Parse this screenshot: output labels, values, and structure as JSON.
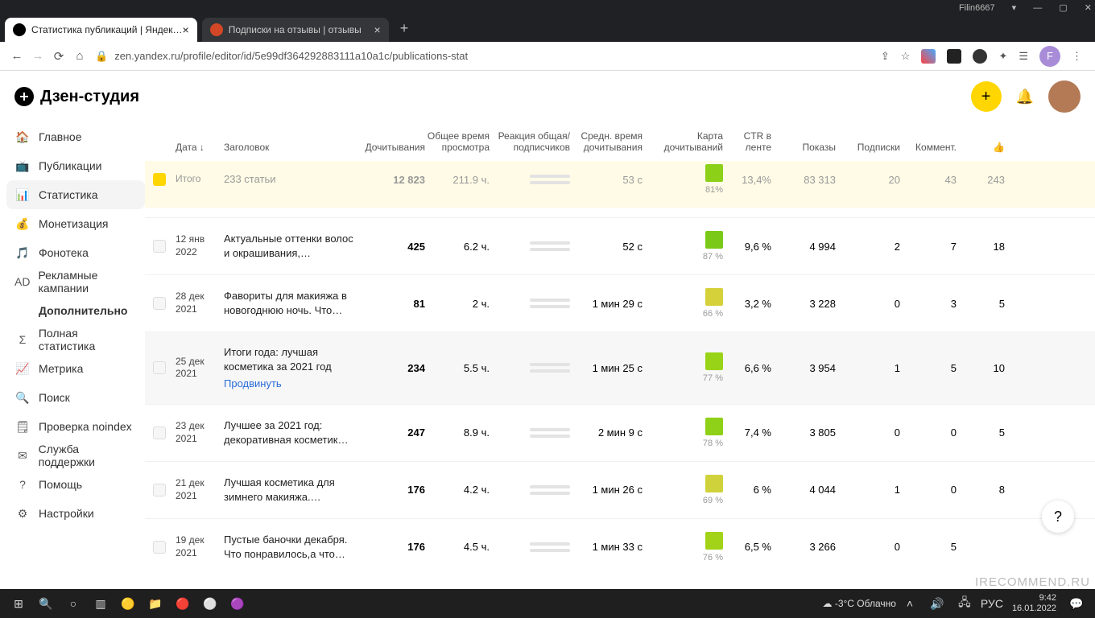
{
  "window": {
    "username": "Filin6667"
  },
  "tabs": [
    {
      "title": "Статистика публикаций | Яндек…"
    },
    {
      "title": "Подписки на отзывы | отзывы"
    }
  ],
  "url": "zen.yandex.ru/profile/editor/id/5e99df364292883111a10a1c/publications-stat",
  "avatar_initial": "F",
  "logo_text": "Дзен-студия",
  "sidebar": {
    "items": [
      {
        "icon": "🏠",
        "label": "Главное"
      },
      {
        "icon": "📺",
        "label": "Публикации"
      },
      {
        "icon": "📊",
        "label": "Статистика",
        "active": true
      },
      {
        "icon": "💰",
        "label": "Монетизация"
      },
      {
        "icon": "🎵",
        "label": "Фонотека"
      },
      {
        "icon": "AD",
        "label": "Рекламные кампании"
      },
      {
        "icon": "",
        "label": "Дополнительно",
        "bold": true
      },
      {
        "icon": "Σ",
        "label": "Полная статистика"
      },
      {
        "icon": "📈",
        "label": "Метрика"
      },
      {
        "icon": "🔍",
        "label": "Поиск"
      },
      {
        "icon": "🗒",
        "label": "Проверка noindex"
      },
      {
        "icon": "✉",
        "label": "Служба поддержки"
      },
      {
        "icon": "?",
        "label": "Помощь"
      },
      {
        "icon": "⚙",
        "label": "Настройки"
      }
    ]
  },
  "columns": {
    "date": "Дата",
    "title": "Заголовок",
    "reads": "Дочитывания",
    "watch": "Общее время просмотра",
    "react": "Реакция общая/ подписчиков",
    "avg": "Средн. время дочитывания",
    "card": "Карта дочитываний",
    "ctr": "CTR в ленте",
    "shows": "Показы",
    "subs": "Подписки",
    "comm": "Коммент.",
    "likes": "👍"
  },
  "summary": {
    "date": "Итого",
    "title": "233 статьи",
    "reads": "12 823",
    "watch": "211.9 ч.",
    "avg": "53 с",
    "card_pct": "81%",
    "ctr": "13,4%",
    "shows": "83 313",
    "subs": "20",
    "comm": "43",
    "likes": "243"
  },
  "rows": [
    {
      "date1": "12 янв",
      "date2": "2022",
      "title": "Актуальные оттенки волос и окрашивания,…",
      "reads": "425",
      "watch": "6.2 ч.",
      "avg": "52 с",
      "card_color": "#7ac918",
      "card_pct": "87 %",
      "ctr": "9,6 %",
      "shows": "4 994",
      "subs": "2",
      "comm": "7",
      "likes": "18"
    },
    {
      "date1": "28 дек",
      "date2": "2021",
      "title": "Фавориты для макияжа в новогоднюю ночь. Что…",
      "reads": "81",
      "watch": "2 ч.",
      "avg": "1 мин 29 с",
      "card_color": "#d5d13a",
      "card_pct": "66 %",
      "ctr": "3,2 %",
      "shows": "3 228",
      "subs": "0",
      "comm": "3",
      "likes": "5"
    },
    {
      "date1": "25 дек",
      "date2": "2021",
      "title": "Итоги года: лучшая косметика за 2021 год",
      "reads": "234",
      "watch": "5.5 ч.",
      "avg": "1 мин 25 с",
      "card_color": "#99d318",
      "card_pct": "77 %",
      "ctr": "6,6 %",
      "shows": "3 954",
      "subs": "1",
      "comm": "5",
      "likes": "10",
      "hover": true,
      "promote": "Продвинуть"
    },
    {
      "date1": "23 дек",
      "date2": "2021",
      "title": "Лучшее за 2021 год: декоративная косметик…",
      "reads": "247",
      "watch": "8.9 ч.",
      "avg": "2 мин 9 с",
      "card_color": "#8fd018",
      "card_pct": "78 %",
      "ctr": "7,4 %",
      "shows": "3 805",
      "subs": "0",
      "comm": "0",
      "likes": "5"
    },
    {
      "date1": "21 дек",
      "date2": "2021",
      "title": "Лучшая косметика для зимнего макияжа.…",
      "reads": "176",
      "watch": "4.2 ч.",
      "avg": "1 мин 26 с",
      "card_color": "#cfd23a",
      "card_pct": "69 %",
      "ctr": "6 %",
      "shows": "4 044",
      "subs": "1",
      "comm": "0",
      "likes": "8"
    },
    {
      "date1": "19 дек",
      "date2": "2021",
      "title": "Пустые баночки декабря. Что понравилось,а что…",
      "reads": "176",
      "watch": "4.5 ч.",
      "avg": "1 мин 33 с",
      "card_color": "#a2d318",
      "card_pct": "76 %",
      "ctr": "6,5 %",
      "shows": "3 266",
      "subs": "0",
      "comm": "5",
      "likes": ""
    }
  ],
  "weather": "-3°C Облачно",
  "clock": {
    "time": "9:42",
    "date": "16.01.2022"
  },
  "watermark": "IRECOMMEND.RU"
}
